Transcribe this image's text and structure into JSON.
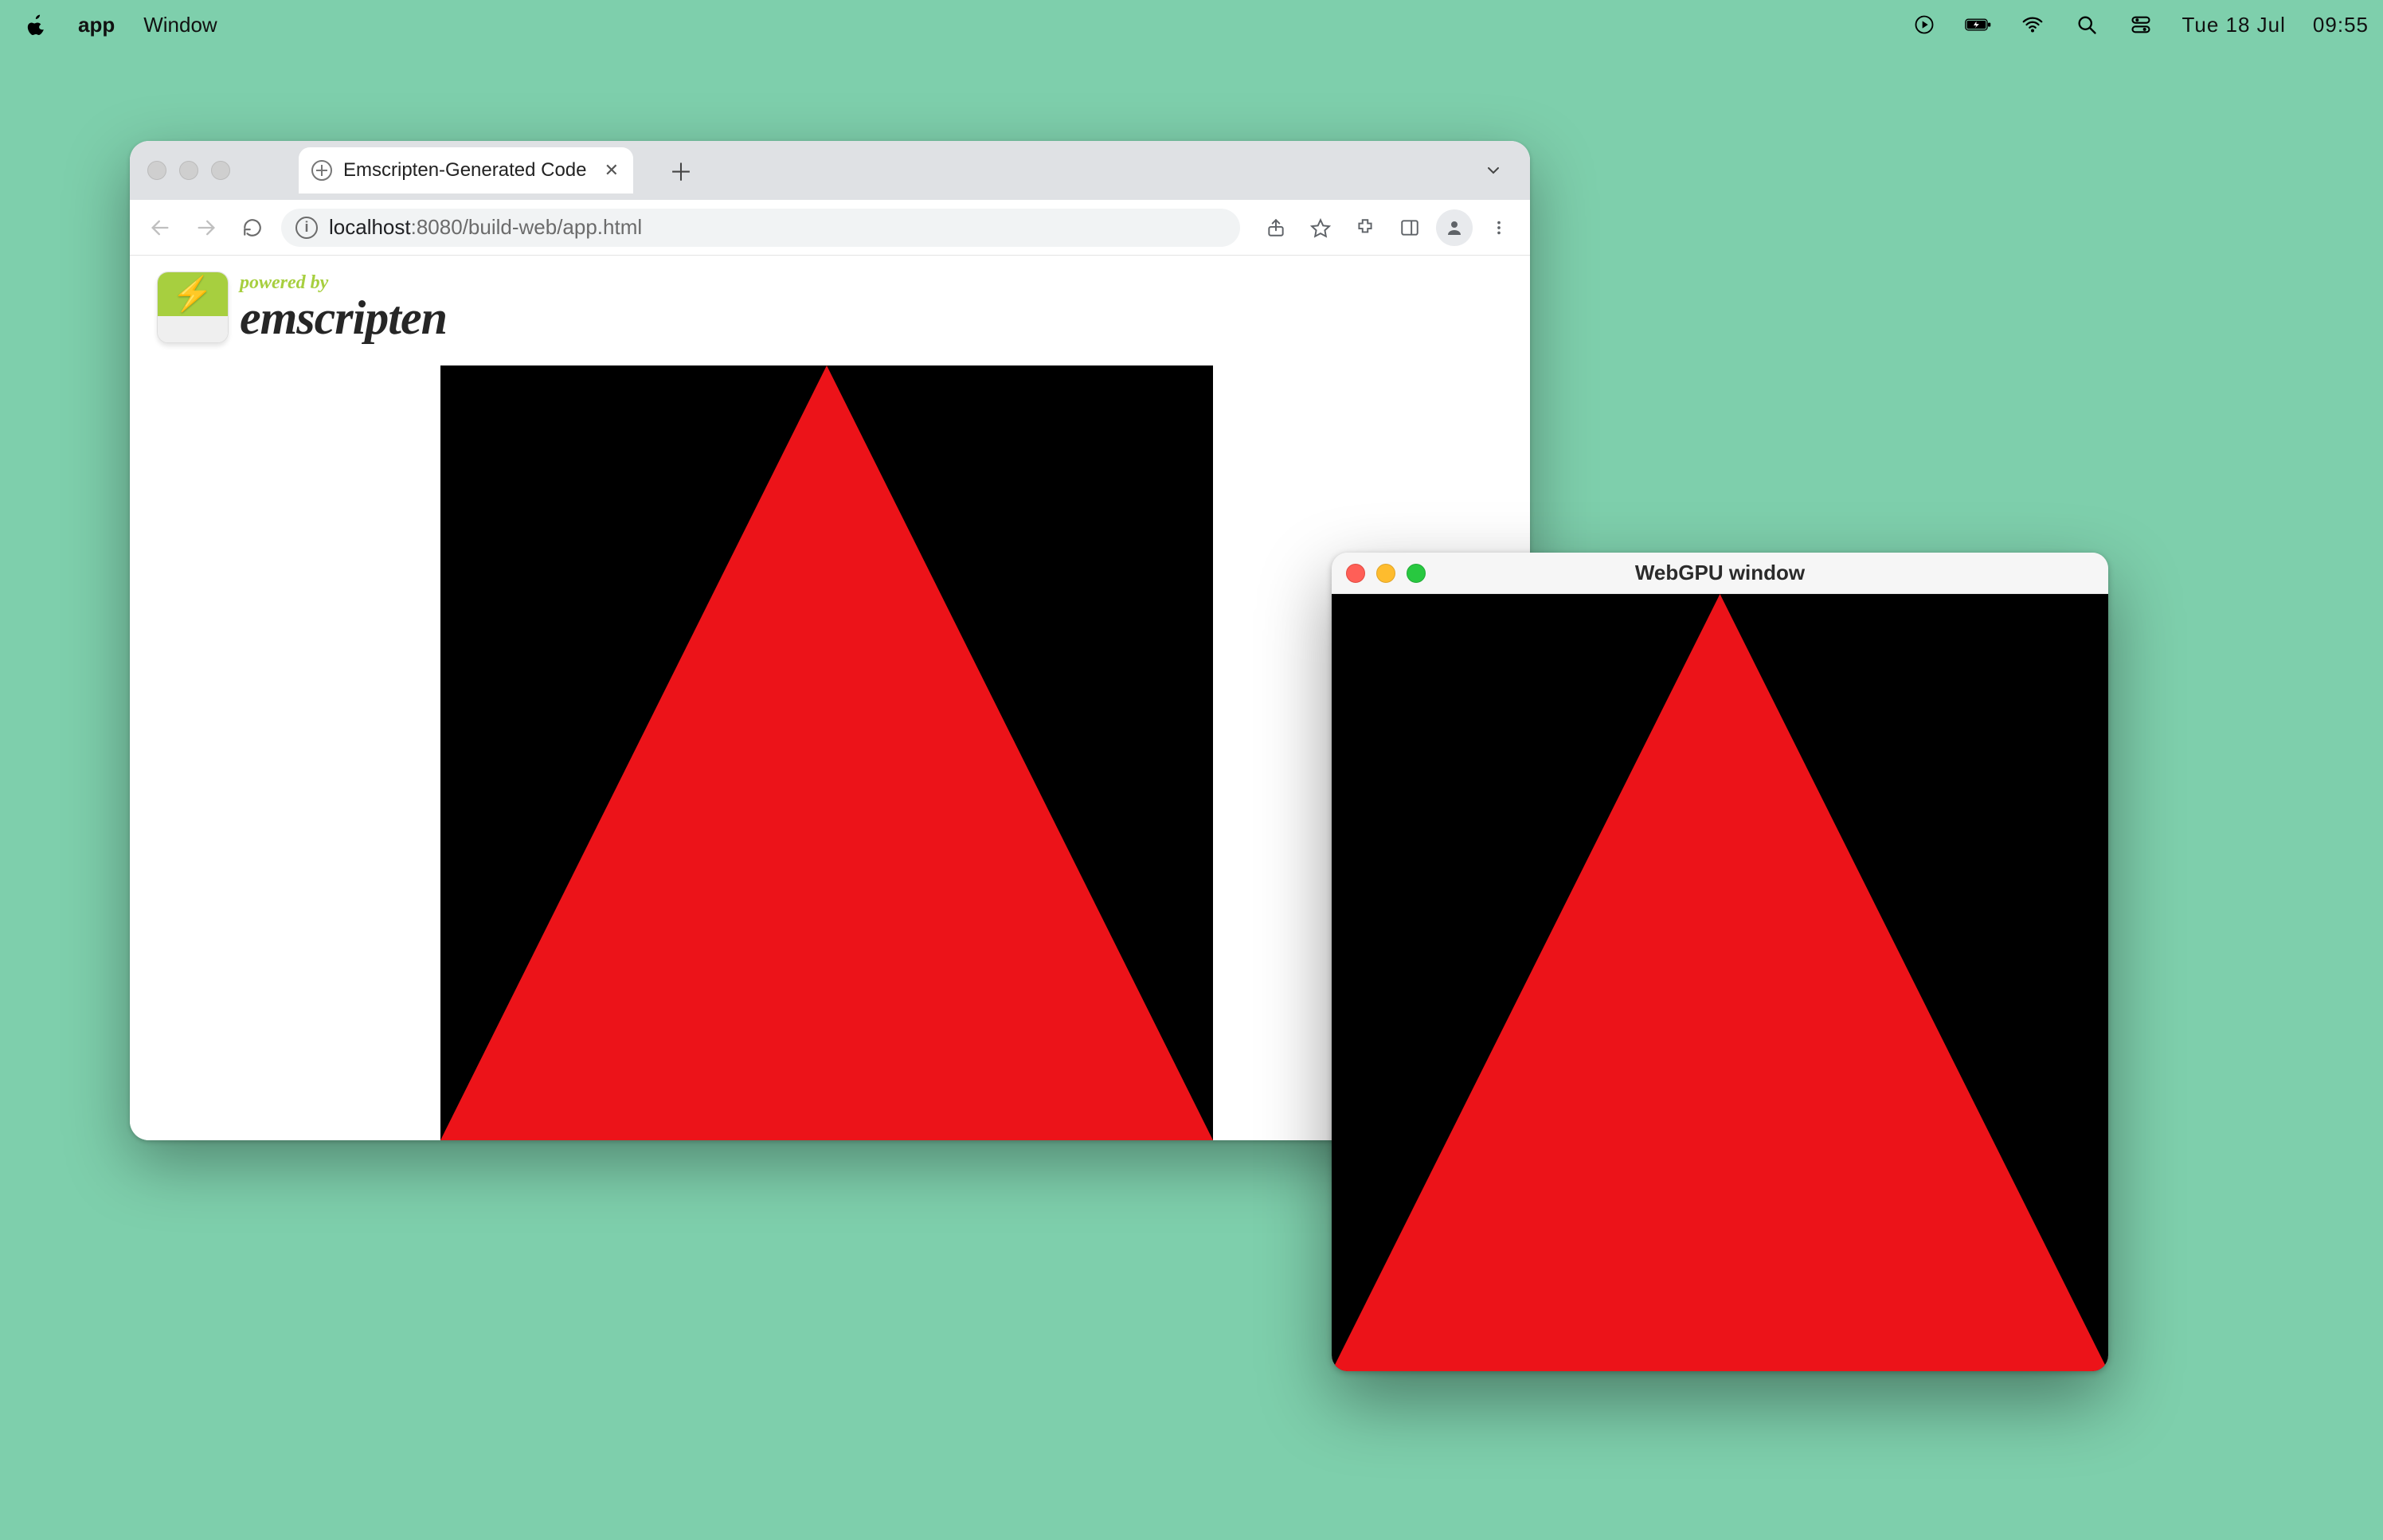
{
  "menubar": {
    "app_name": "app",
    "menu_window": "Window",
    "date_label": "Tue 18 Jul",
    "time_label": "09:55"
  },
  "browser": {
    "tab_title": "Emscripten-Generated Code",
    "url_host": "localhost",
    "url_port_path": ":8080/build-web/app.html"
  },
  "emscripten": {
    "powered_by_label": "powered by",
    "wordmark": "emscripten"
  },
  "native_window": {
    "title": "WebGPU window"
  }
}
